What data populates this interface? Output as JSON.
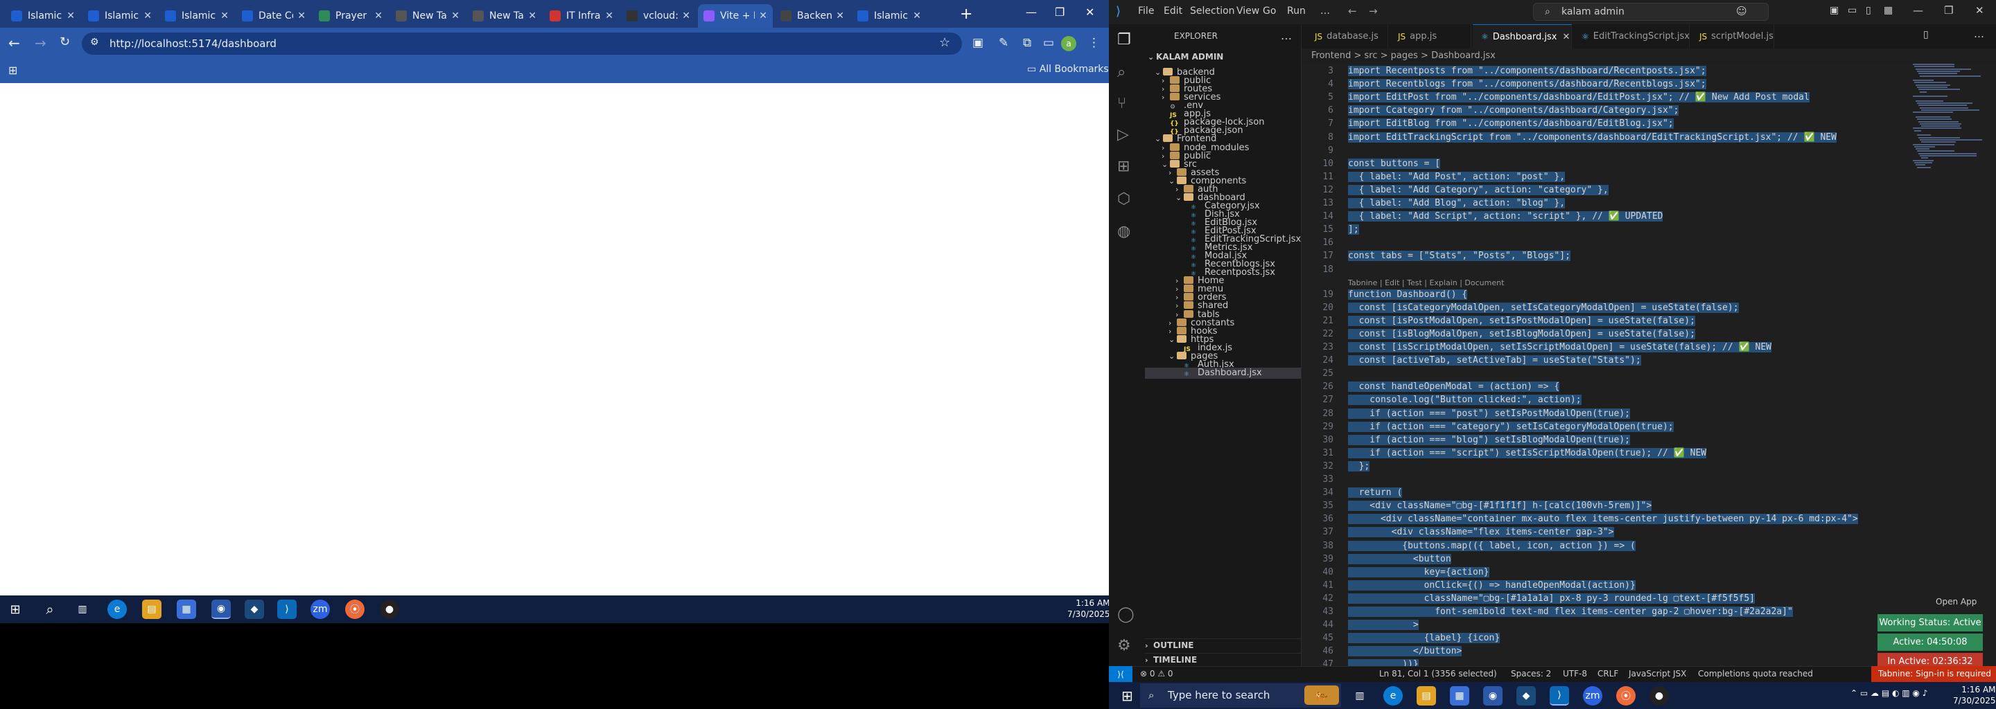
{
  "chrome": {
    "tabs": [
      {
        "label": "Islamic",
        "color": "#1d5fd1"
      },
      {
        "label": "Islamic",
        "color": "#1d5fd1"
      },
      {
        "label": "Islamic",
        "color": "#1d5fd1"
      },
      {
        "label": "Date Co",
        "color": "#1d5fd1"
      },
      {
        "label": "Prayer",
        "color": "#2e8b57"
      },
      {
        "label": "New Ta",
        "color": "#555555"
      },
      {
        "label": "New Ta",
        "color": "#555555"
      },
      {
        "label": "IT Infra",
        "color": "#d0342c"
      },
      {
        "label": "vcloud:",
        "color": "#333333"
      },
      {
        "label": "Vite + R",
        "color": "#8e5cff"
      },
      {
        "label": "Backen",
        "color": "#444444"
      },
      {
        "label": "Islamic",
        "color": "#1d5fd1"
      }
    ],
    "url": "http://localhost:5174/dashboard",
    "all_bookmarks": "All Bookmarks",
    "avatar_letter": "a"
  },
  "taskbar_left": {
    "time": "1:16 AM",
    "date": "7/30/2025"
  },
  "vscode": {
    "menu": [
      "File",
      "Edit",
      "Selection",
      "View",
      "Go",
      "Run",
      "…"
    ],
    "search": "kalam admin",
    "explorer_title": "EXPLORER",
    "tree": [
      {
        "label": "KALAM ADMIN",
        "depth": 0,
        "kind": "root"
      },
      {
        "label": "backend",
        "depth": 1,
        "kind": "folder-open"
      },
      {
        "label": "public",
        "depth": 2,
        "kind": "folder"
      },
      {
        "label": "routes",
        "depth": 2,
        "kind": "folder"
      },
      {
        "label": "services",
        "depth": 2,
        "kind": "folder"
      },
      {
        "label": ".env",
        "depth": 2,
        "kind": "file"
      },
      {
        "label": "app.js",
        "depth": 2,
        "kind": "js"
      },
      {
        "label": "package-lock.json",
        "depth": 2,
        "kind": "json"
      },
      {
        "label": "package.json",
        "depth": 2,
        "kind": "json"
      },
      {
        "label": "Frontend",
        "depth": 1,
        "kind": "folder-open"
      },
      {
        "label": "node_modules",
        "depth": 2,
        "kind": "folder"
      },
      {
        "label": "public",
        "depth": 2,
        "kind": "folder"
      },
      {
        "label": "src",
        "depth": 2,
        "kind": "folder-open"
      },
      {
        "label": "assets",
        "depth": 3,
        "kind": "folder"
      },
      {
        "label": "components",
        "depth": 3,
        "kind": "folder-open"
      },
      {
        "label": "auth",
        "depth": 4,
        "kind": "folder"
      },
      {
        "label": "dashboard",
        "depth": 4,
        "kind": "folder-open"
      },
      {
        "label": "Category.jsx",
        "depth": 5,
        "kind": "jsx"
      },
      {
        "label": "Dish.jsx",
        "depth": 5,
        "kind": "jsx"
      },
      {
        "label": "EditBlog.jsx",
        "depth": 5,
        "kind": "jsx"
      },
      {
        "label": "EditPost.jsx",
        "depth": 5,
        "kind": "jsx"
      },
      {
        "label": "EditTrackingScript.jsx",
        "depth": 5,
        "kind": "jsx"
      },
      {
        "label": "Metrics.jsx",
        "depth": 5,
        "kind": "jsx"
      },
      {
        "label": "Modal.jsx",
        "depth": 5,
        "kind": "jsx"
      },
      {
        "label": "Recentblogs.jsx",
        "depth": 5,
        "kind": "jsx"
      },
      {
        "label": "Recentposts.jsx",
        "depth": 5,
        "kind": "jsx"
      },
      {
        "label": "Home",
        "depth": 4,
        "kind": "folder"
      },
      {
        "label": "menu",
        "depth": 4,
        "kind": "folder"
      },
      {
        "label": "orders",
        "depth": 4,
        "kind": "folder"
      },
      {
        "label": "shared",
        "depth": 4,
        "kind": "folder"
      },
      {
        "label": "tabls",
        "depth": 4,
        "kind": "folder"
      },
      {
        "label": "constants",
        "depth": 3,
        "kind": "folder"
      },
      {
        "label": "hooks",
        "depth": 3,
        "kind": "folder"
      },
      {
        "label": "https",
        "depth": 3,
        "kind": "folder-open"
      },
      {
        "label": "index.js",
        "depth": 4,
        "kind": "js"
      },
      {
        "label": "pages",
        "depth": 3,
        "kind": "folder-open"
      },
      {
        "label": "Auth.jsx",
        "depth": 4,
        "kind": "jsx"
      },
      {
        "label": "Dashboard.jsx",
        "depth": 4,
        "kind": "jsx",
        "selected": true
      }
    ],
    "outline": "OUTLINE",
    "timeline": "TIMELINE",
    "editor_tabs": [
      "database.js",
      "app.js",
      "Dashboard.jsx",
      "EditTrackingScript.jsx",
      "scriptModel.js"
    ],
    "active_tab_index": 2,
    "breadcrumb": "Frontend > src > pages > Dashboard.jsx",
    "lens": "Tabnine | Edit | Test | Explain | Document",
    "lines": [
      {
        "n": "3",
        "t": "import Recentposts from \"../components/dashboard/Recentposts.jsx\";"
      },
      {
        "n": "4",
        "t": "import Recentblogs from \"../components/dashboard/Recentblogs.jsx\";"
      },
      {
        "n": "5",
        "t": "import EditPost from \"../components/dashboard/EditPost.jsx\"; // ✅ New Add Post modal"
      },
      {
        "n": "6",
        "t": "import Ccategory from \"../components/dashboard/Category.jsx\";"
      },
      {
        "n": "7",
        "t": "import EditBlog from \"../components/dashboard/EditBlog.jsx\";"
      },
      {
        "n": "8",
        "t": "import EditTrackingScript from \"../components/dashboard/EditTrackingScript.jsx\"; // ✅ NEW"
      },
      {
        "n": "9",
        "t": ""
      },
      {
        "n": "10",
        "t": "const buttons = ["
      },
      {
        "n": "11",
        "t": "  { label: \"Add Post\", action: \"post\" },"
      },
      {
        "n": "12",
        "t": "  { label: \"Add Category\", action: \"category\" },"
      },
      {
        "n": "13",
        "t": "  { label: \"Add Blog\", action: \"blog\" },"
      },
      {
        "n": "14",
        "t": "  { label: \"Add Script\", action: \"script\" }, // ✅ UPDATED"
      },
      {
        "n": "15",
        "t": "];"
      },
      {
        "n": "16",
        "t": ""
      },
      {
        "n": "17",
        "t": "const tabs = [\"Stats\", \"Posts\", \"Blogs\"];"
      },
      {
        "n": "18",
        "t": ""
      },
      {
        "n": "19",
        "t": "function Dashboard() {"
      },
      {
        "n": "20",
        "t": "  const [isCategoryModalOpen, setIsCategoryModalOpen] = useState(false);"
      },
      {
        "n": "21",
        "t": "  const [isPostModalOpen, setIsPostModalOpen] = useState(false);"
      },
      {
        "n": "22",
        "t": "  const [isBlogModalOpen, setIsBlogModalOpen] = useState(false);"
      },
      {
        "n": "23",
        "t": "  const [isScriptModalOpen, setIsScriptModalOpen] = useState(false); // ✅ NEW"
      },
      {
        "n": "24",
        "t": "  const [activeTab, setActiveTab] = useState(\"Stats\");"
      },
      {
        "n": "25",
        "t": ""
      },
      {
        "n": "26",
        "t": "  const handleOpenModal = (action) => {"
      },
      {
        "n": "27",
        "t": "    console.log(\"Button clicked:\", action);"
      },
      {
        "n": "28",
        "t": "    if (action === \"post\") setIsPostModalOpen(true);"
      },
      {
        "n": "29",
        "t": "    if (action === \"category\") setIsCategoryModalOpen(true);"
      },
      {
        "n": "30",
        "t": "    if (action === \"blog\") setIsBlogModalOpen(true);"
      },
      {
        "n": "31",
        "t": "    if (action === \"script\") setIsScriptModalOpen(true); // ✅ NEW"
      },
      {
        "n": "32",
        "t": "  };"
      },
      {
        "n": "33",
        "t": ""
      },
      {
        "n": "34",
        "t": "  return ("
      },
      {
        "n": "35",
        "t": "    <div className=\"▢bg-[#1f1f1f] h-[calc(100vh-5rem)]\">"
      },
      {
        "n": "36",
        "t": "      <div className=\"container mx-auto flex items-center justify-between py-14 px-6 md:px-4\">"
      },
      {
        "n": "37",
        "t": "        <div className=\"flex items-center gap-3\">"
      },
      {
        "n": "38",
        "t": "          {buttons.map(({ label, icon, action }) => ("
      },
      {
        "n": "39",
        "t": "            <button"
      },
      {
        "n": "40",
        "t": "              key={action}"
      },
      {
        "n": "41",
        "t": "              onClick={() => handleOpenModal(action)}"
      },
      {
        "n": "42",
        "t": "              className=\"▢bg-[#1a1a1a] px-8 py-3 rounded-lg ▢text-[#f5f5f5]"
      },
      {
        "n": "43",
        "t": "                font-semibold text-md flex items-center gap-2 ▢hover:bg-[#2a2a2a]\""
      },
      {
        "n": "44",
        "t": "            >"
      },
      {
        "n": "45",
        "t": "              {label} {icon}"
      },
      {
        "n": "46",
        "t": "            </button>"
      },
      {
        "n": "47",
        "t": "          ))}"
      }
    ],
    "status": {
      "errors": "⊗ 0 ⚠ 0",
      "position": "Ln 81, Col 1 (3356 selected)",
      "spaces": "Spaces: 2",
      "encoding": "UTF-8",
      "eol": "CRLF",
      "language": "JavaScript JSX",
      "quota": "Completions quota reached",
      "tabnine": "Tabnine: Sign-in is required"
    },
    "open_app": "Open App",
    "badges": [
      {
        "label": "Working Status: Active",
        "color": "#2e8b57"
      },
      {
        "label": "Active: 04:50:08",
        "color": "#2e8b57"
      },
      {
        "label": "In Active: 02:36:32",
        "color": "#c0392b"
      }
    ]
  },
  "taskbar_right": {
    "search_placeholder": "Type here to search",
    "time": "1:16 AM",
    "date": "7/30/2025"
  }
}
